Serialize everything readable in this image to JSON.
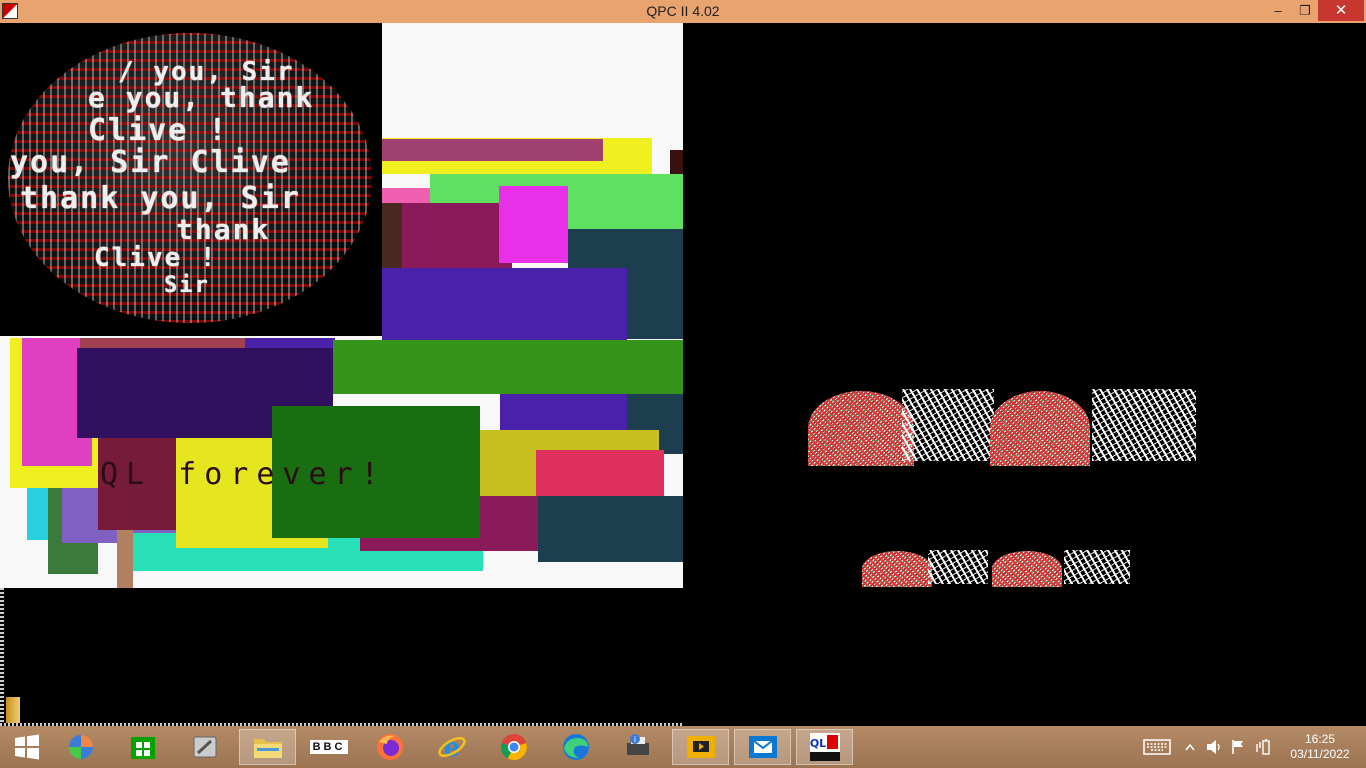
{
  "window": {
    "title": "QPC II 4.02",
    "controls": {
      "minimize": "–",
      "maximize": "❐",
      "close": "✕"
    }
  },
  "ql_screen": {
    "banner_text": "QL  forever!",
    "globe_lines": [
      "/ you, Sir",
      "e you, thank",
      "Clive !",
      "you, Sir  Clive",
      "thank  you, Sir",
      "thank",
      "Clive !",
      "Sir"
    ]
  },
  "taskbar": {
    "items": [
      {
        "name": "windows-start-button",
        "icon": "windows-logo-icon"
      },
      {
        "name": "taskbar-app-1",
        "icon": "colorful-ball-icon"
      },
      {
        "name": "taskbar-store",
        "icon": "store-icon"
      },
      {
        "name": "taskbar-app-3",
        "icon": "scanner-icon"
      },
      {
        "name": "taskbar-file-explorer",
        "icon": "folder-icon"
      },
      {
        "name": "taskbar-bbc",
        "icon": "bbc-icon",
        "label": "BBC"
      },
      {
        "name": "taskbar-firefox",
        "icon": "firefox-icon"
      },
      {
        "name": "taskbar-internet-explorer",
        "icon": "ie-icon"
      },
      {
        "name": "taskbar-chrome",
        "icon": "chrome-icon"
      },
      {
        "name": "taskbar-edge",
        "icon": "edge-icon"
      },
      {
        "name": "taskbar-printer",
        "icon": "printer-icon"
      },
      {
        "name": "taskbar-media",
        "icon": "media-icon"
      },
      {
        "name": "taskbar-mail",
        "icon": "mail-icon"
      },
      {
        "name": "taskbar-qpc",
        "icon": "qpc-icon"
      }
    ],
    "clock": {
      "time": "16:25",
      "date": "03/11/2022"
    }
  }
}
